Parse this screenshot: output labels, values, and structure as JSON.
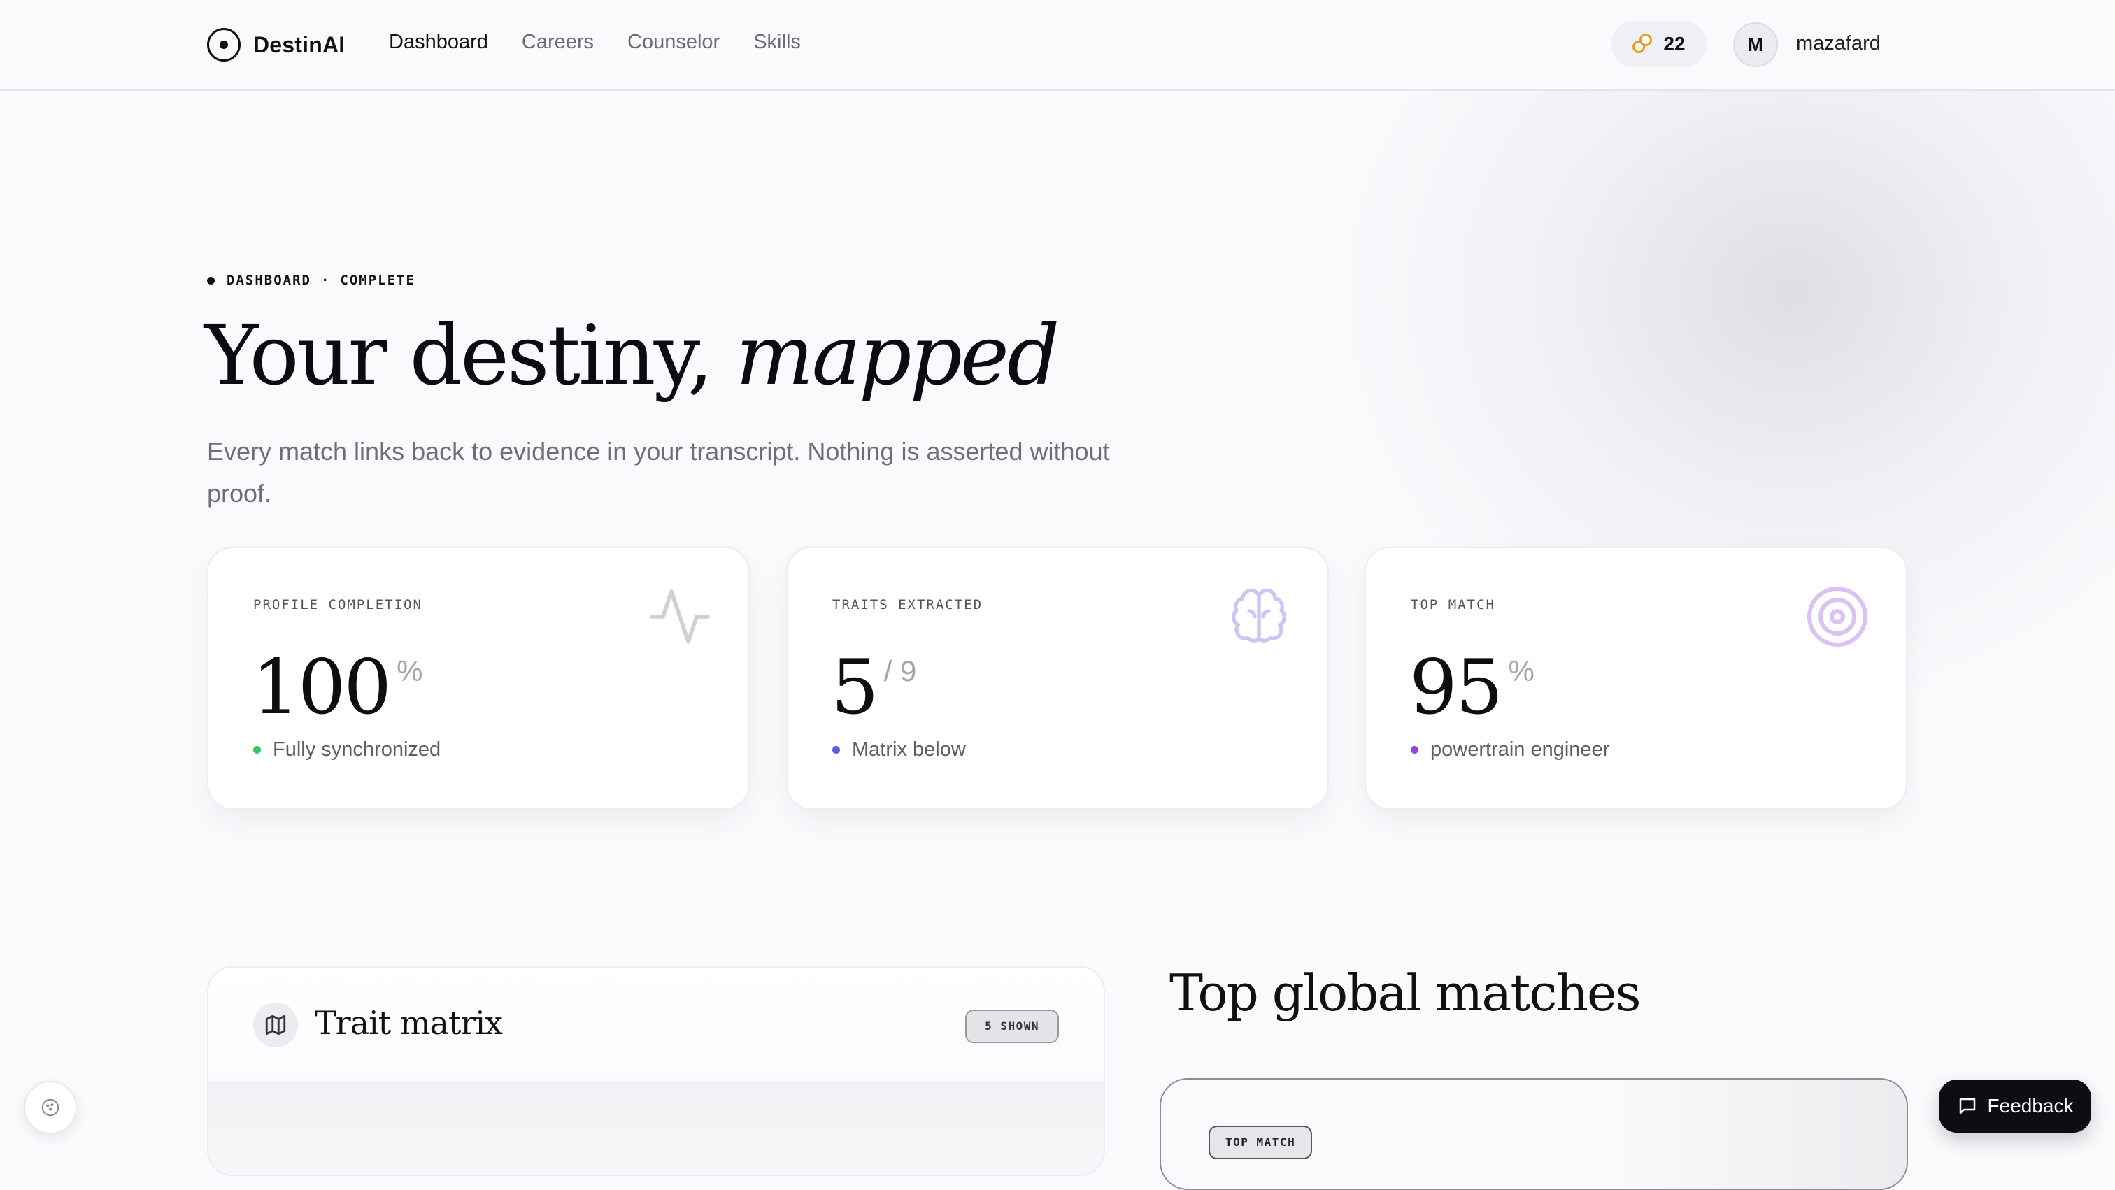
{
  "nav": {
    "brand": "DestinAI",
    "links": [
      {
        "label": "Dashboard"
      },
      {
        "label": "Careers"
      },
      {
        "label": "Counselor"
      },
      {
        "label": "Skills"
      }
    ],
    "active_link": "Dashboard",
    "credits": "22",
    "avatar_initial": "M",
    "username": "mazafard"
  },
  "hero": {
    "eyebrow_left": "DASHBOARD",
    "eyebrow_sep": "·",
    "eyebrow_right": "COMPLETE",
    "title_main": "Your destiny, ",
    "title_italic": "mapped",
    "subtitle": "Every match links back to evidence in your transcript. Nothing is asserted without proof."
  },
  "stats": [
    {
      "label": "PROFILE COMPLETION",
      "value": "100",
      "unit": "%",
      "note": "Fully synchronized",
      "dot_color": "#3cc35a",
      "icon": "activity-icon"
    },
    {
      "label": "TRAITS EXTRACTED",
      "value": "5",
      "unit": "/ 9",
      "note": "Matrix below",
      "dot_color": "#5b5bdc",
      "icon": "brain-icon"
    },
    {
      "label": "TOP MATCH",
      "value": "95",
      "unit": "%",
      "note": "powertrain engineer",
      "dot_color": "#9b45e6",
      "icon": "target-icon"
    }
  ],
  "trait_matrix": {
    "title": "Trait matrix",
    "badge": "5 SHOWN",
    "icon": "map-icon"
  },
  "matches": {
    "title": "Top global matches",
    "card_badge": "TOP MATCH"
  },
  "feedback": {
    "label": "Feedback"
  },
  "colors": {
    "background": "#fafafd",
    "credit_accent": "#e3a21a",
    "brain_icon": "#c9c7f2",
    "target_icon": "#d9c3f3"
  }
}
